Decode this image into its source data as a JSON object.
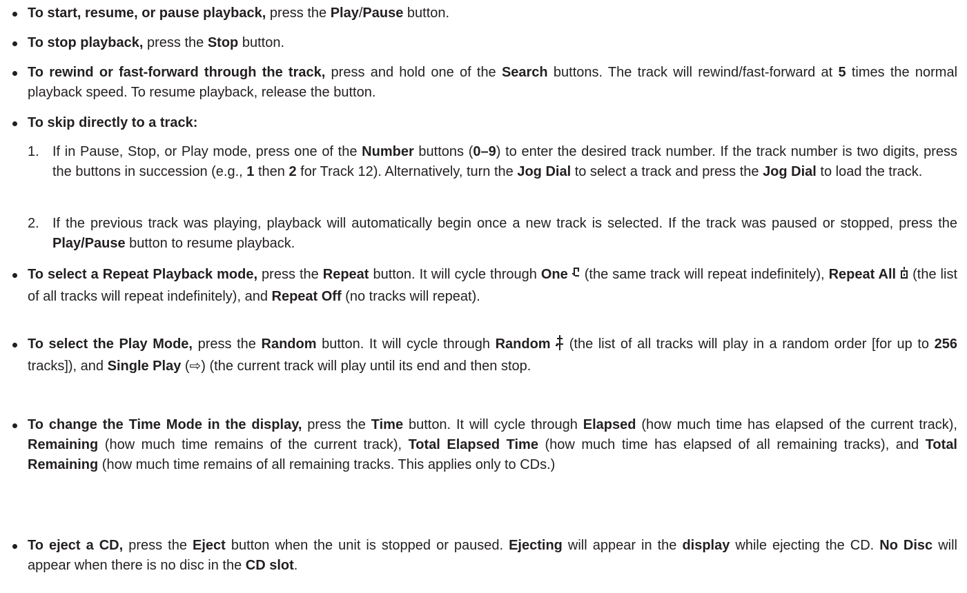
{
  "bullets": [
    {
      "b1": "To start, resume, or pause playback,",
      "t1": " press the ",
      "b2": "Play",
      "t2": "/",
      "b3": "Pause",
      "t3": " button."
    },
    {
      "b1": "To stop playback,",
      "t1": " press the ",
      "b2": "Stop",
      "t2": " button."
    },
    {
      "b1": "To rewind or fast-forward through the track,",
      "t1": " press and hold one of the ",
      "b2": "Search",
      "t2": " buttons. The track will rewind/fast-forward at ",
      "b3": "5",
      "t3": " times the normal playback speed. To resume playback, release the button."
    },
    {
      "b1": "To skip directly to a track:"
    },
    {
      "b1": "To select a Repeat Playback mode,",
      "t1": " press the ",
      "b2": "Repeat",
      "t2": " button. It will cycle through ",
      "b3": "One",
      "t3": " (the same track will repeat indefinitely), ",
      "b4": "Repeat All",
      "t4": " (the list of all tracks will repeat indefinitely), and ",
      "b5": "Repeat Off",
      "t5": " (no tracks will repeat)."
    },
    {
      "b1": "To select the Play Mode,",
      "t1": " press the ",
      "b2": "Random",
      "t2": " button. It will cycle through ",
      "b3": "Random",
      "t3": " (the list of all tracks will play in a random order [for up to ",
      "b4": "256",
      "t4": " tracks]), and ",
      "b5": "Single Play",
      "t5": " (⇨) (the current track will play until its end and then stop."
    },
    {
      "b1": "To change the Time Mode in the display,",
      "t1": " press the ",
      "b2": "Time",
      "t2": " button. It will cycle through ",
      "b3": "Elapsed",
      "t3": " (how much time has elapsed of the current track), ",
      "b4": "Remaining",
      "t4": " (how much time remains of the current track), ",
      "b5": "Total Elapsed Time",
      "t5": " (how much time has elapsed of all remaining tracks), and ",
      "b6": "Total Remaining",
      "t6": " (how much time remains of all remaining tracks. This applies only to CDs.)"
    },
    {
      "b1": "To eject a CD,",
      "t1": " press the ",
      "b2": "Eject",
      "t2": " button when the unit is stopped or paused. ",
      "b3": "Ejecting",
      "t3": " will appear in the ",
      "b4": "display",
      "t4": " while ejecting the CD. ",
      "b5": "No Disc",
      "t5": " will appear when there is no disc in the ",
      "b6": "CD slot",
      "t6": "."
    }
  ],
  "steps": [
    {
      "num": "1.",
      "t1": "If in Pause, Stop, or Play mode, press one of the ",
      "b1": "Number",
      "t2": " buttons (",
      "b2": "0–9",
      "t3": ") to enter the desired track number. If the track number is two digits, press the buttons in succession (e.g., ",
      "b3": "1",
      "t4": " then ",
      "b4": "2",
      "t5": " for Track 12). Alternatively, turn the ",
      "b5": "Jog Dial",
      "t6": " to select a track and press the ",
      "b6": "Jog Dial",
      "t7": " to load the track."
    },
    {
      "num": "2.",
      "t1": "If the previous track was playing, playback will automatically begin once a new track is selected. If the track was paused or stopped, press the ",
      "b1": "Play/Pause",
      "t2": " button to resume playback."
    }
  ],
  "icons": {
    "repeat_one": "repeat-one-icon",
    "repeat_all": "repeat-all-icon",
    "random": "random-icon"
  }
}
